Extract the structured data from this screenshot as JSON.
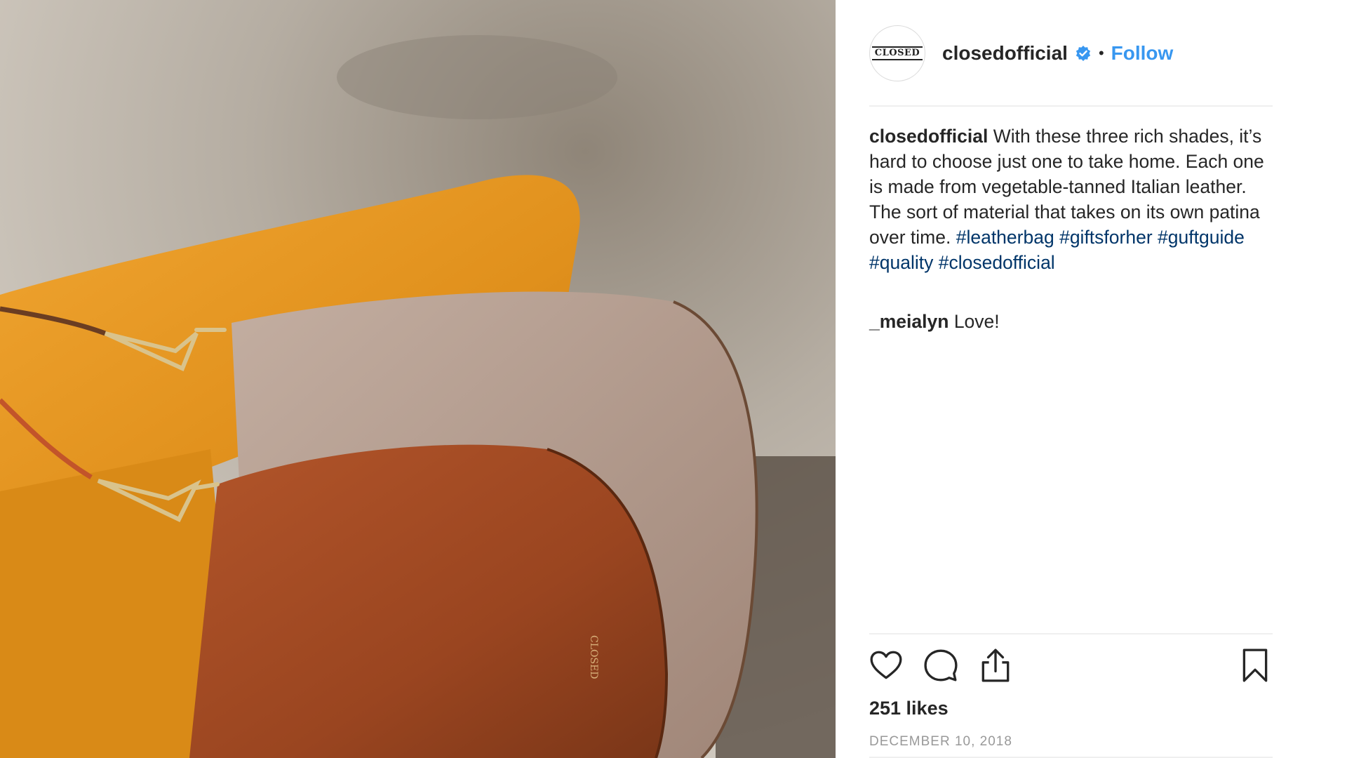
{
  "post": {
    "image_alt": "Leather shoulder bags in tan and brown on a mustard chair",
    "bag_logo_text": "CLOSED"
  },
  "header": {
    "avatar_logo": "CLOSED",
    "username": "closedofficial",
    "verified_icon": "verified-badge-icon",
    "separator": "•",
    "follow_label": "Follow"
  },
  "caption": {
    "username": "closedofficial",
    "text": "With these three rich shades, it’s hard to choose just one to take home. Each one is made from vegetable-tanned Italian leather. The sort of material that takes on its own patina over time.",
    "hashtags": [
      "#leatherbag",
      "#giftsforher",
      "#guftguide",
      "#quality",
      "#closedofficial"
    ]
  },
  "comments": [
    {
      "username": "_meialyn",
      "text": "Love!"
    }
  ],
  "actions": {
    "like_icon": "heart-icon",
    "comment_icon": "comment-icon",
    "share_icon": "share-icon",
    "save_icon": "bookmark-icon"
  },
  "likes_text": "251 likes",
  "date_text": "DECEMBER 10, 2018",
  "colors": {
    "accent": "#3897f0",
    "hashtag": "#003569",
    "text": "#262626",
    "muted": "#999999",
    "divider": "#efefef"
  }
}
